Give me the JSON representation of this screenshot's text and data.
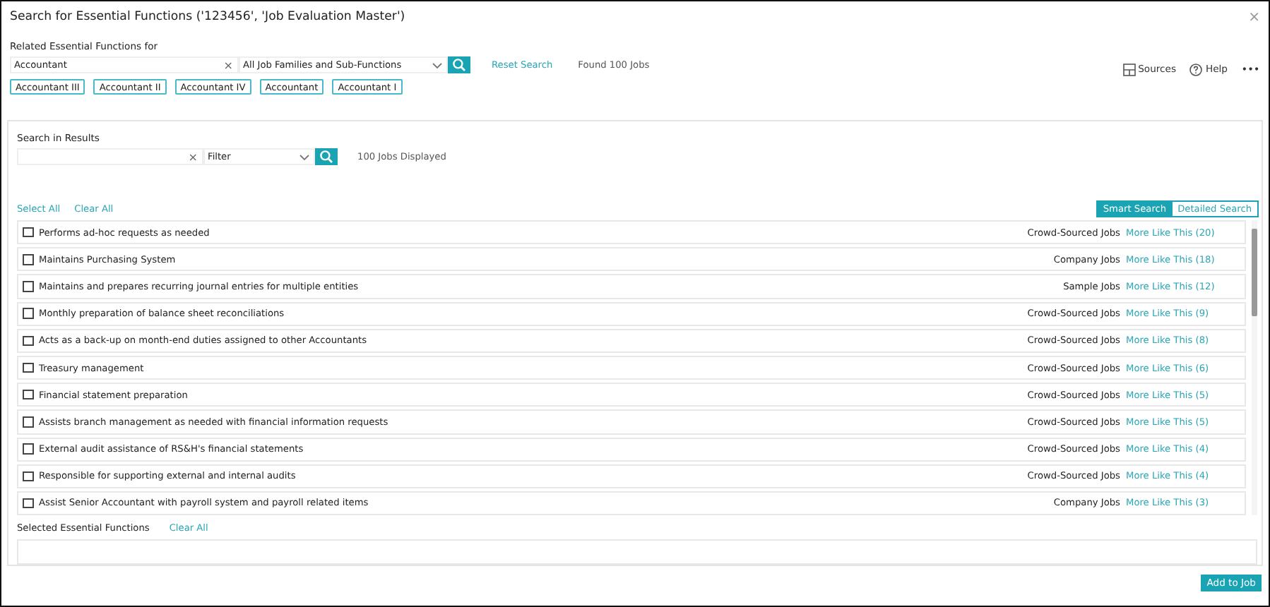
{
  "dialog": {
    "title": "Search for Essential Functions ('123456', 'Job Evaluation Master')",
    "close": "×"
  },
  "related": {
    "label": "Related Essential Functions for",
    "value": "Accountant",
    "clear": "×",
    "family": "All Job Families and Sub-Functions",
    "reset": "Reset Search",
    "found": "Found 100 Jobs"
  },
  "toolbar": [
    {
      "kind": "sources",
      "label": "Sources"
    },
    {
      "kind": "help",
      "label": "Help"
    },
    {
      "kind": "more",
      "label": "•••"
    }
  ],
  "tags": [
    "Accountant III",
    "Accountant II",
    "Accountant IV",
    "Accountant",
    "Accountant I"
  ],
  "results": {
    "label": "Search in Results",
    "clear": "×",
    "filter": "Filter",
    "displayed": "100 Jobs Displayed",
    "select_all": "Select All",
    "clear_all": "Clear All"
  },
  "modes": [
    {
      "label": "Smart Search",
      "selected": true
    },
    {
      "label": "Detailed Search",
      "selected": false
    }
  ],
  "rows": [
    {
      "text": "Performs ad-hoc requests as needed",
      "checked": false,
      "source": "Crowd-Sourced Jobs",
      "link": "More Like This (20)"
    },
    {
      "text": "Maintains Purchasing System",
      "checked": false,
      "source": "Company Jobs",
      "link": "More Like This (18)"
    },
    {
      "text": "Maintains and prepares recurring journal entries for multiple entities",
      "checked": false,
      "source": "Sample Jobs",
      "link": "More Like This (12)"
    },
    {
      "text": "Monthly preparation of balance sheet reconciliations",
      "checked": false,
      "source": "Crowd-Sourced Jobs",
      "link": "More Like This (9)"
    },
    {
      "text": "Acts as a back-up on month-end duties assigned to other Accountants",
      "checked": false,
      "source": "Crowd-Sourced Jobs",
      "link": "More Like This (8)"
    },
    {
      "text": "Treasury management",
      "checked": false,
      "source": "Crowd-Sourced Jobs",
      "link": "More Like This (6)"
    },
    {
      "text": "Financial statement preparation",
      "checked": false,
      "source": "Crowd-Sourced Jobs",
      "link": "More Like This (5)"
    },
    {
      "text": "Assists branch management as needed with financial information requests",
      "checked": false,
      "source": "Crowd-Sourced Jobs",
      "link": "More Like This (5)"
    },
    {
      "text": "External audit assistance of RS&H's financial statements",
      "checked": false,
      "source": "Crowd-Sourced Jobs",
      "link": "More Like This (4)"
    },
    {
      "text": "Responsible for supporting external and internal audits",
      "checked": false,
      "source": "Crowd-Sourced Jobs",
      "link": "More Like This (4)"
    },
    {
      "text": "Assist Senior Accountant with payroll system and payroll related items",
      "checked": false,
      "source": "Company Jobs",
      "link": "More Like This (3)"
    }
  ],
  "selected_section": {
    "label": "Selected Essential Functions",
    "clear_all": "Clear All"
  },
  "buttons": [
    "Add to Job"
  ]
}
